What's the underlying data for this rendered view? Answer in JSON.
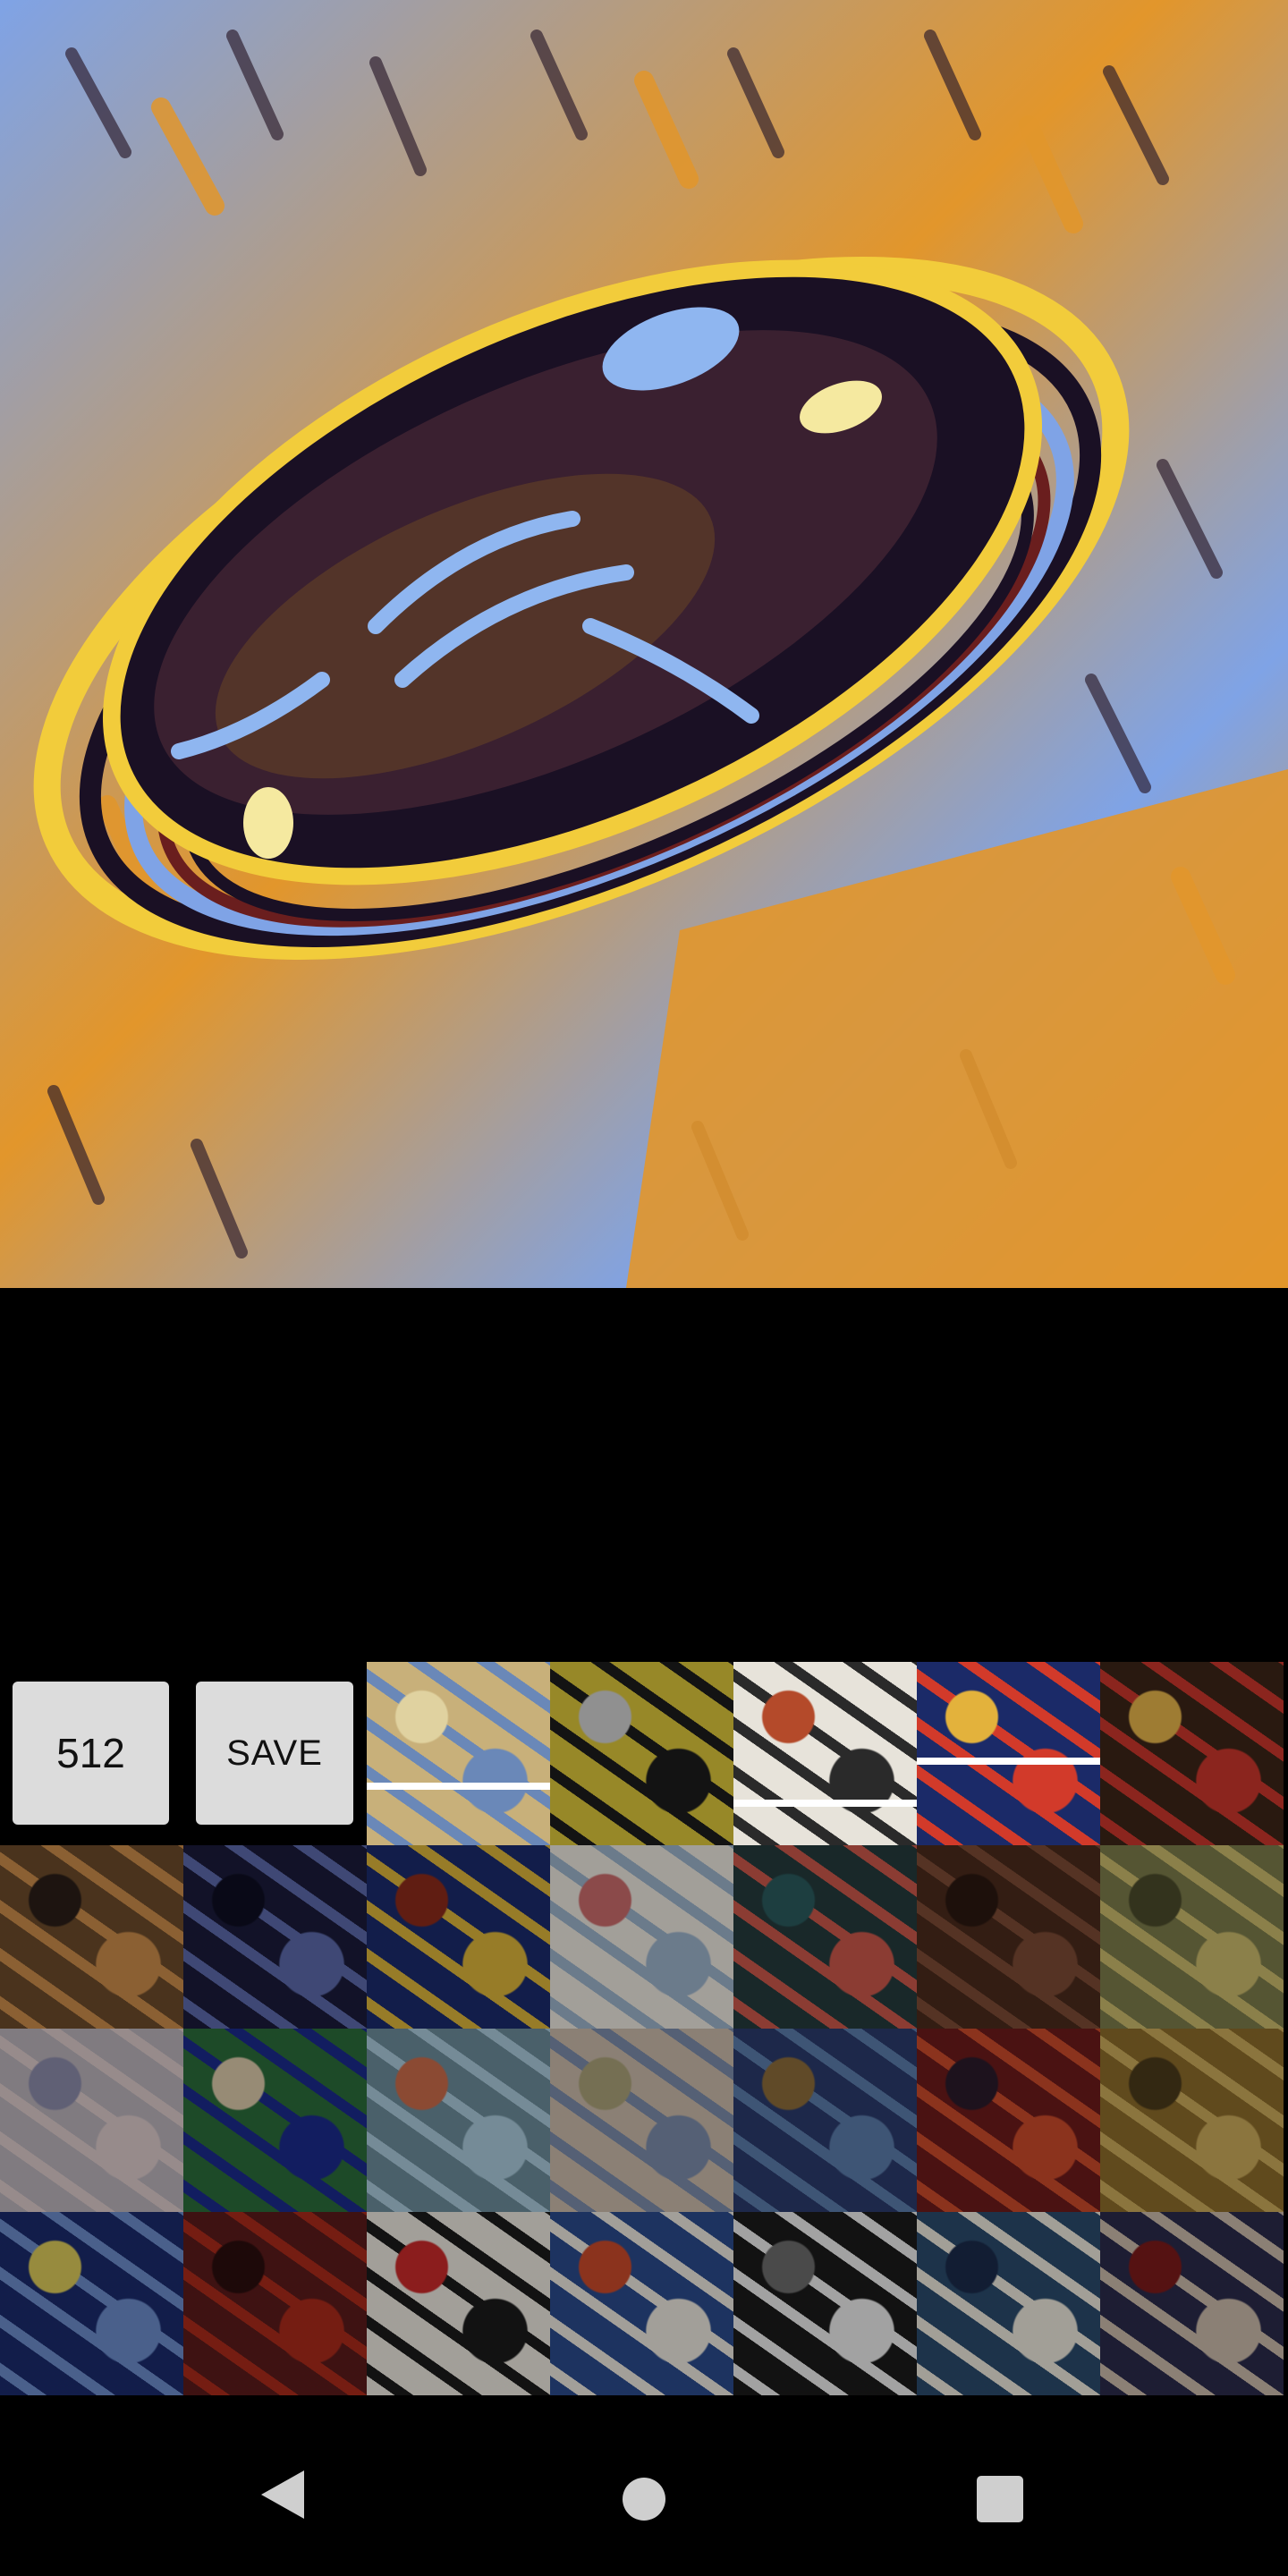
{
  "preview": {
    "style_colors": {
      "sky_blue": "#7fa3e6",
      "orange": "#e2962b",
      "yellow": "#f2cc3b",
      "dark": "#1a1024",
      "maroon": "#6a1e1e"
    }
  },
  "controls": {
    "size_label": "512",
    "save_label": "SAVE"
  },
  "styles": [
    {
      "name": "style-1",
      "colors": [
        "#c8b07a",
        "#6a88b8",
        "#e0d2a0"
      ],
      "selected": true,
      "bar": 0.66
    },
    {
      "name": "style-2",
      "colors": [
        "#d8c33a",
        "#1c1c1c",
        "#cfcfcf"
      ],
      "selected": false
    },
    {
      "name": "style-3",
      "colors": [
        "#e7e3da",
        "#2a2a2a",
        "#b44a2a"
      ],
      "selected": true,
      "bar": 0.75
    },
    {
      "name": "style-4",
      "colors": [
        "#1b2a68",
        "#d23a2a",
        "#e3b23c"
      ],
      "selected": true,
      "bar": 0.52
    },
    {
      "name": "style-5",
      "colors": [
        "#3b2418",
        "#c8362b",
        "#e3b24a"
      ],
      "selected": false
    },
    {
      "name": "style-6",
      "colors": [
        "#6a4a2a",
        "#c88a4a",
        "#2a1e18"
      ],
      "selected": false
    },
    {
      "name": "style-7",
      "colors": [
        "#1a1b3a",
        "#5b68a8",
        "#0e0e22"
      ],
      "selected": false
    },
    {
      "name": "style-8",
      "colors": [
        "#1a2a6a",
        "#d8b23a",
        "#8a2a1a"
      ],
      "selected": false
    },
    {
      "name": "style-9",
      "colors": [
        "#e8e4dc",
        "#9ab0c8",
        "#c86a6a"
      ],
      "selected": false
    },
    {
      "name": "style-10",
      "colors": [
        "#243a3c",
        "#c8564a",
        "#2a5a5c"
      ],
      "selected": false
    },
    {
      "name": "style-11",
      "colors": [
        "#4a2a1c",
        "#7a4a34",
        "#2a1810"
      ],
      "selected": false
    },
    {
      "name": "style-12",
      "colors": [
        "#7a7a4a",
        "#c8b86a",
        "#4a4a2a"
      ],
      "selected": false
    },
    {
      "name": "style-13",
      "colors": [
        "#b8b0b8",
        "#d8c8c8",
        "#8a8aa8"
      ],
      "selected": false
    },
    {
      "name": "style-14",
      "colors": [
        "#2a6a3a",
        "#1a2a8a",
        "#d8c8a8"
      ],
      "selected": false
    },
    {
      "name": "style-15",
      "colors": [
        "#6a8a98",
        "#a8c8d8",
        "#c86a4a"
      ],
      "selected": false
    },
    {
      "name": "style-16",
      "colors": [
        "#c8b8a8",
        "#7a8aa8",
        "#a8a078"
      ],
      "selected": false
    },
    {
      "name": "style-17",
      "colors": [
        "#2a3a6a",
        "#5a7aa8",
        "#8a6a3a"
      ],
      "selected": false
    },
    {
      "name": "style-18",
      "colors": [
        "#6a1a1a",
        "#c84a2a",
        "#2a1a2a"
      ],
      "selected": false
    },
    {
      "name": "style-19",
      "colors": [
        "#8a6a2a",
        "#c8a85a",
        "#4a3a1a"
      ],
      "selected": false
    },
    {
      "name": "style-20",
      "colors": [
        "#1a2a6a",
        "#6a8ac8",
        "#d8c85a"
      ],
      "selected": false
    },
    {
      "name": "style-21",
      "colors": [
        "#5a1a1a",
        "#a82a1a",
        "#2a0e0e"
      ],
      "selected": false
    },
    {
      "name": "style-22",
      "colors": [
        "#e8e4dc",
        "#1a1a1a",
        "#c82a2a"
      ],
      "selected": false
    },
    {
      "name": "style-23",
      "colors": [
        "#2a4a8a",
        "#e8e4dc",
        "#c84a2a"
      ],
      "selected": false
    },
    {
      "name": "style-24",
      "colors": [
        "#1a1a1a",
        "#e8e8e8",
        "#6a6a6a"
      ],
      "selected": false
    },
    {
      "name": "style-25",
      "colors": [
        "#2a4a6a",
        "#e8e4d8",
        "#1a2a4a"
      ],
      "selected": false
    },
    {
      "name": "style-26",
      "colors": [
        "#2a2a4a",
        "#c8b8a8",
        "#7a1a1a"
      ],
      "selected": false
    }
  ],
  "nav": {
    "back": "back-icon",
    "home": "home-icon",
    "recents": "recents-icon"
  }
}
